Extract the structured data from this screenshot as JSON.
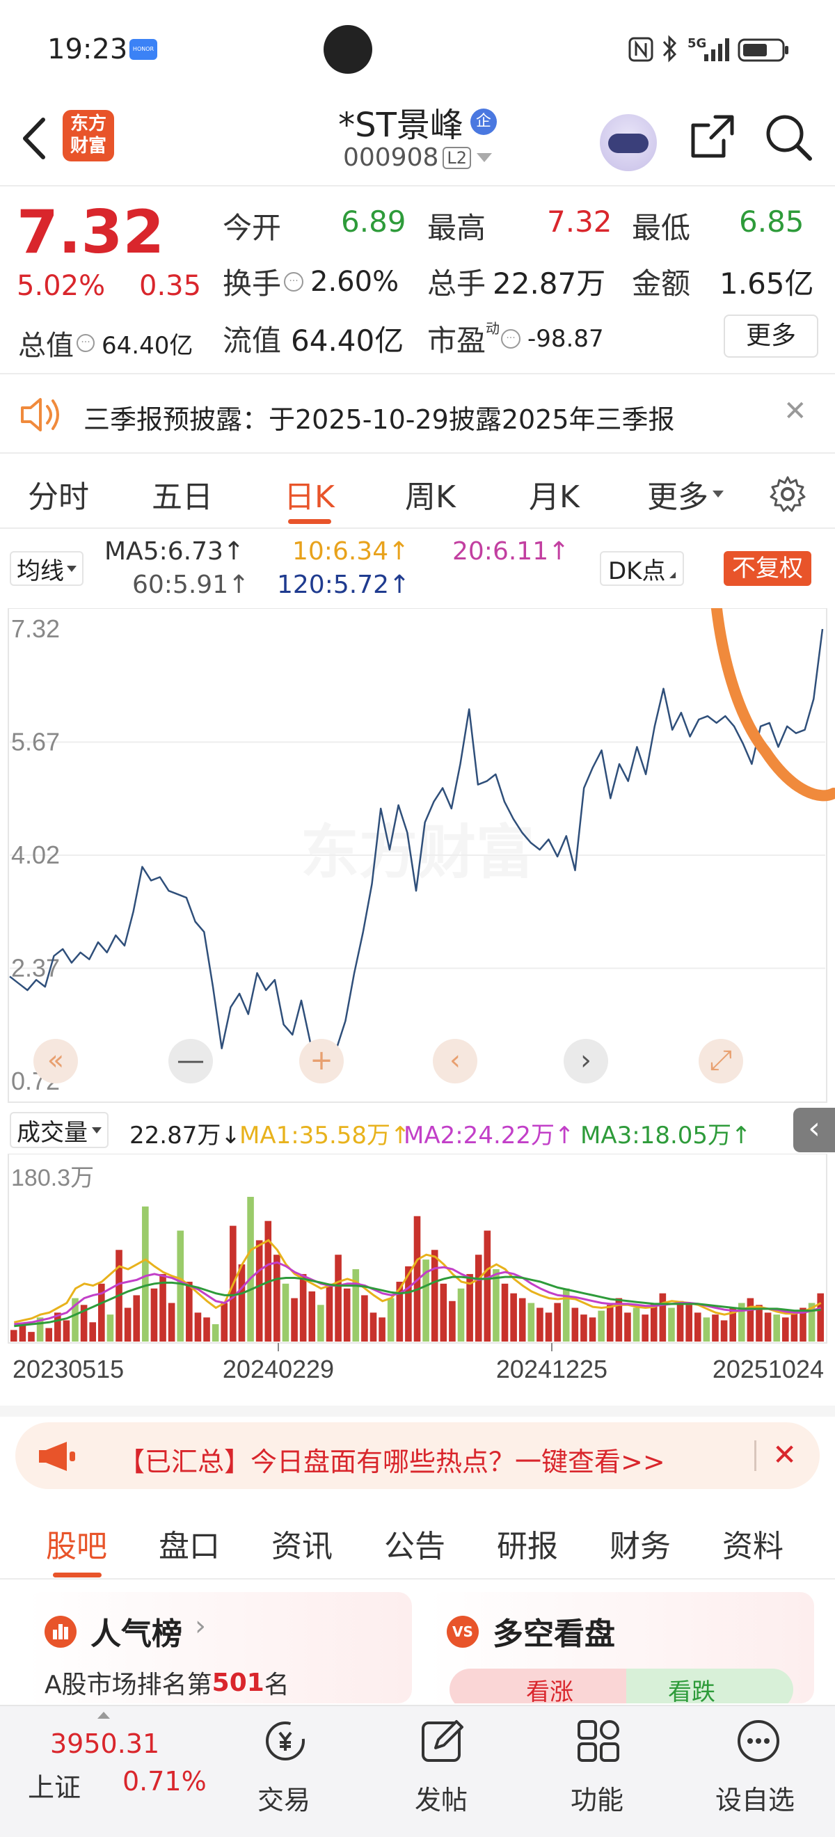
{
  "status_bar": {
    "time": "19:23",
    "brand_badge": "HONOR",
    "network": "5G",
    "icons": [
      "nfc-icon",
      "bluetooth-icon",
      "signal-icon",
      "battery-icon"
    ]
  },
  "header": {
    "back_icon": "chevron-left-icon",
    "logo_line1": "东方",
    "logo_line2": "财富",
    "stock_name": "*ST景峰",
    "stock_tag": "企",
    "stock_code": "000908",
    "level_badge": "L2",
    "share_icon": "share-icon",
    "search_icon": "search-icon"
  },
  "quote": {
    "price": "7.32",
    "change_pct": "5.02%",
    "change_amt": "0.35",
    "open_label": "今开",
    "open_value": "6.89",
    "high_label": "最高",
    "high_value": "7.32",
    "low_label": "最低",
    "low_value": "6.85",
    "turnover_label": "换手",
    "turnover_value": "2.60%",
    "volume_label": "总手",
    "volume_value": "22.87万",
    "amount_label": "金额",
    "amount_value": "1.65亿",
    "total_mv_label": "总值",
    "total_mv_value": "64.40亿",
    "float_mv_label": "流值",
    "float_mv_value": "64.40亿",
    "pe_label": "市盈",
    "pe_sup": "动",
    "pe_value": "-98.87",
    "more_button": "更多"
  },
  "notice": {
    "text": "三季报预披露：于2025-10-29披露2025年三季报",
    "close": "✕"
  },
  "period_tabs": {
    "items": [
      "分时",
      "五日",
      "日K",
      "周K",
      "月K",
      "更多"
    ],
    "active": 2
  },
  "ma_legend": {
    "selector": "均线",
    "ma5": "MA5:6.73↑",
    "ma10": "10:6.34↑",
    "ma20": "20:6.11↑",
    "ma60": "60:5.91↑",
    "ma120": "120:5.72↑",
    "dk_button": "DK点",
    "fq_button": "不复权"
  },
  "colors": {
    "brand_red": "#d9262c",
    "accent_orange": "#f08a3c",
    "ma5_color": "#333333",
    "ma10_color": "#e8a21c",
    "ma20_color": "#c23fa0",
    "ma60_color": "#555555",
    "ma120_color": "#1f3b8f"
  },
  "chart_data": [
    {
      "type": "line",
      "ylim": [
        0.72,
        7.32
      ],
      "y_ticks": [
        "7.32",
        "5.67",
        "4.02",
        "2.37",
        "0.72"
      ],
      "series": [
        {
          "values": [
            2.25,
            2.15,
            2.05,
            2.2,
            2.1,
            2.55,
            2.65,
            2.45,
            2.6,
            2.5,
            2.75,
            2.6,
            2.85,
            2.7,
            3.2,
            3.85,
            3.65,
            3.7,
            3.5,
            3.45,
            3.4,
            3.05,
            2.9,
            2.1,
            1.2,
            1.8,
            2.0,
            1.7,
            2.3,
            2.05,
            2.2,
            1.55,
            1.4,
            1.9,
            1.3,
            0.95,
            0.75,
            1.2,
            1.6,
            2.3,
            2.9,
            3.6,
            4.7,
            4.1,
            4.75,
            4.35,
            3.5,
            4.5,
            4.8,
            5.0,
            4.7,
            5.35,
            6.15,
            5.05,
            5.1,
            5.2,
            4.8,
            4.55,
            4.35,
            4.2,
            4.1,
            4.25,
            4.0,
            4.3,
            3.8,
            5.0,
            5.3,
            5.55,
            4.85,
            5.35,
            5.1,
            5.6,
            5.2,
            5.9,
            6.45,
            5.85,
            6.1,
            5.75,
            6.0,
            6.05,
            5.95,
            6.05,
            5.9,
            5.65,
            5.35,
            5.9,
            5.95,
            5.6,
            5.9,
            5.8,
            5.85,
            6.3,
            7.32
          ]
        }
      ]
    },
    {
      "type": "bar",
      "ylim": [
        0,
        180.3
      ],
      "y_ticks": [
        "180.3万"
      ],
      "x_ticks": [
        "20230515",
        "20240229",
        "20241225",
        "20251024"
      ],
      "values": [
        12,
        18,
        10,
        25,
        14,
        30,
        22,
        45,
        38,
        20,
        60,
        28,
        95,
        35,
        48,
        140,
        55,
        70,
        40,
        115,
        62,
        30,
        25,
        18,
        40,
        120,
        80,
        150,
        105,
        125,
        90,
        60,
        45,
        70,
        52,
        38,
        60,
        90,
        55,
        75,
        48,
        30,
        25,
        45,
        62,
        78,
        130,
        85,
        95,
        60,
        42,
        55,
        70,
        90,
        115,
        75,
        60,
        50,
        45,
        40,
        35,
        30,
        40,
        55,
        35,
        28,
        25,
        32,
        38,
        45,
        30,
        35,
        28,
        40,
        50,
        35,
        42,
        38,
        30,
        25,
        28,
        22,
        35,
        40,
        45,
        38,
        30,
        28,
        25,
        30,
        35,
        40,
        50
      ],
      "ma1": [
        20,
        22,
        24,
        28,
        30,
        35,
        40,
        55,
        60,
        58,
        62,
        70,
        78,
        75,
        80,
        85,
        78,
        72,
        68,
        65,
        58,
        50,
        42,
        35,
        40,
        60,
        80,
        95,
        100,
        105,
        95,
        80,
        70,
        65,
        60,
        55,
        58,
        62,
        65,
        62,
        55,
        48,
        42,
        45,
        55,
        70,
        85,
        90,
        88,
        80,
        70,
        62,
        60,
        65,
        75,
        80,
        75,
        65,
        58,
        52,
        48,
        45,
        44,
        45,
        44,
        40,
        36,
        35,
        36,
        38,
        38,
        36,
        35,
        36,
        40,
        42,
        41,
        40,
        38,
        34,
        30,
        28,
        30,
        33,
        36,
        36,
        34,
        31,
        29,
        29,
        31,
        35,
        40
      ],
      "ma2": [
        18,
        19,
        20,
        22,
        24,
        27,
        30,
        38,
        45,
        48,
        50,
        55,
        60,
        62,
        64,
        68,
        70,
        68,
        66,
        62,
        58,
        54,
        48,
        42,
        40,
        46,
        56,
        66,
        74,
        80,
        82,
        78,
        72,
        68,
        64,
        60,
        58,
        58,
        60,
        60,
        58,
        54,
        50,
        48,
        50,
        56,
        64,
        72,
        76,
        77,
        75,
        70,
        66,
        64,
        66,
        70,
        72,
        70,
        66,
        60,
        55,
        51,
        48,
        47,
        46,
        44,
        42,
        40,
        39,
        39,
        39,
        38,
        37,
        37,
        38,
        39,
        40,
        40,
        39,
        37,
        35,
        33,
        32,
        32,
        33,
        34,
        34,
        33,
        31,
        30,
        30,
        32,
        35
      ],
      "ma3": [
        16,
        17,
        18,
        19,
        20,
        22,
        24,
        28,
        32,
        36,
        40,
        44,
        48,
        52,
        55,
        58,
        60,
        61,
        61,
        60,
        58,
        56,
        53,
        50,
        48,
        48,
        50,
        54,
        58,
        62,
        65,
        66,
        66,
        65,
        63,
        61,
        59,
        58,
        58,
        58,
        57,
        55,
        53,
        51,
        50,
        51,
        54,
        58,
        62,
        65,
        67,
        67,
        66,
        65,
        65,
        66,
        67,
        67,
        66,
        64,
        62,
        59,
        56,
        54,
        52,
        50,
        48,
        46,
        44,
        43,
        42,
        41,
        40,
        39,
        39,
        39,
        39,
        39,
        39,
        38,
        37,
        36,
        35,
        34,
        34,
        34,
        34,
        34,
        33,
        32,
        32,
        32,
        33
      ]
    }
  ],
  "volume_legend": {
    "selector": "成交量",
    "volume": "22.87万↓",
    "ma1": "MA1:35.58万↑",
    "ma2": "MA2:24.22万↑",
    "ma3": "MA3:18.05万↑"
  },
  "chart_controls": {
    "rewind": "«",
    "zoom_out": "—",
    "zoom_in": "+",
    "prev": "‹",
    "next": "›",
    "fullscreen": "⤢",
    "collapse": "‹"
  },
  "watermark": "东方财富",
  "promo": {
    "text": "【已汇总】今日盘面有哪些热点？一键查看>>",
    "close": "✕"
  },
  "section_tabs": {
    "items": [
      "股吧",
      "盘口",
      "资讯",
      "公告",
      "研报",
      "财务",
      "资料"
    ],
    "active": 0
  },
  "cards": {
    "popularity": {
      "title": "人气榜",
      "text_prefix": "A股市场排名第",
      "rank": "501",
      "text_suffix": "名"
    },
    "long_short": {
      "title": "多空看盘",
      "bull": "看涨",
      "bear": "看跌"
    }
  },
  "bottom_bar": {
    "index_value": "3950.31",
    "index_name": "上证",
    "index_change": "0.71%",
    "items": [
      {
        "label": "交易",
        "icon": "yen-exchange-icon"
      },
      {
        "label": "发帖",
        "icon": "edit-post-icon"
      },
      {
        "label": "功能",
        "icon": "grid-function-icon"
      },
      {
        "label": "设自选",
        "icon": "more-dots-icon"
      }
    ]
  }
}
